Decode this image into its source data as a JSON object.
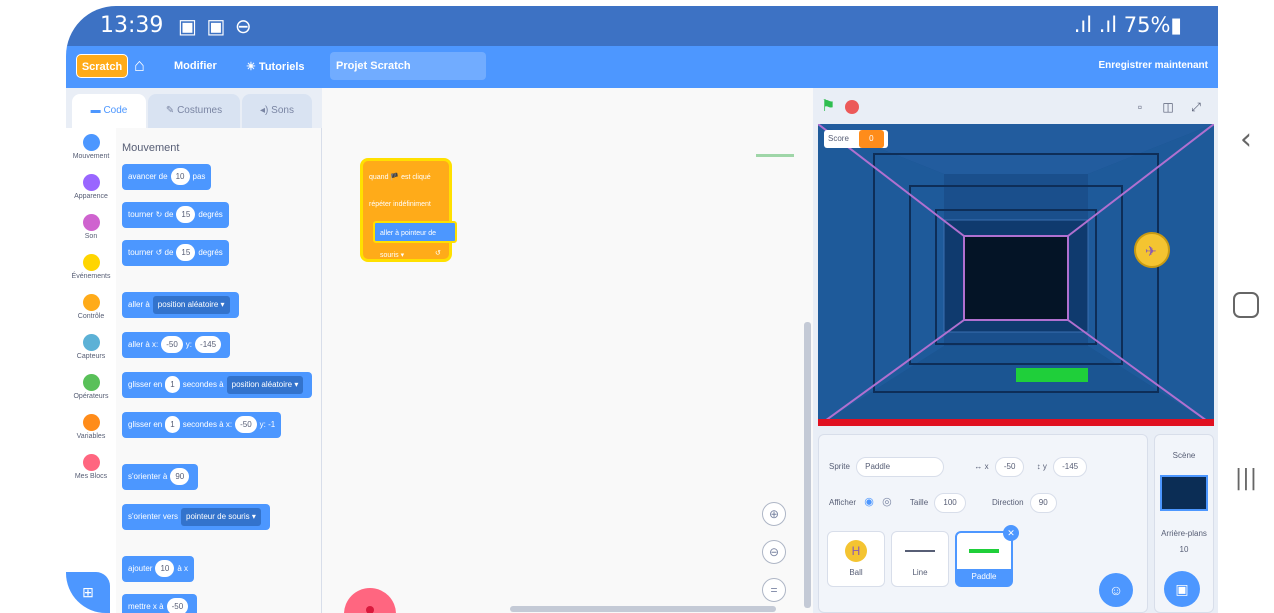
{
  "status_bar": {
    "time": "13:39",
    "left_icons": "▣ ▣ ⊖",
    "right": ".ıl .ıl 75%▮"
  },
  "menu": {
    "logo": "Scratch",
    "items": [
      "Modifier",
      "Tutoriels"
    ],
    "project_title": "Projet Scratch",
    "save_label": "Enregistrer maintenant"
  },
  "tabs": [
    "Code",
    "Costumes",
    "Sons"
  ],
  "categories": [
    {
      "label": "Mouvement",
      "color": "#4c97ff"
    },
    {
      "label": "Apparence",
      "color": "#9966ff"
    },
    {
      "label": "Son",
      "color": "#cf63cf"
    },
    {
      "label": "Événements",
      "color": "#ffd500"
    },
    {
      "label": "Contrôle",
      "color": "#ffab19"
    },
    {
      "label": "Capteurs",
      "color": "#5cb1d6"
    },
    {
      "label": "Opérateurs",
      "color": "#59c059"
    },
    {
      "label": "Variables",
      "color": "#ff8c1a"
    },
    {
      "label": "Mes Blocs",
      "color": "#ff6680"
    }
  ],
  "palette": {
    "title": "Mouvement",
    "blocks": [
      {
        "pre": "avancer de",
        "val": "10",
        "post": "pas"
      },
      {
        "pre": "tourner ↻ de",
        "val": "15",
        "post": "degrés"
      },
      {
        "pre": "tourner ↺ de",
        "val": "15",
        "post": "degrés"
      },
      {
        "pre": "aller à",
        "dd": "position aléatoire ▾",
        "post": ""
      },
      {
        "pre": "aller à x:",
        "val": "-50",
        "mid": "y:",
        "val2": "-145"
      },
      {
        "pre": "glisser en",
        "val": "1",
        "mid": "secondes à",
        "dd": "position aléatoire ▾"
      },
      {
        "pre": "glisser en",
        "val": "1",
        "mid": "secondes à x:",
        "val2": "-50",
        "post": "y: -1"
      },
      {
        "pre": "s'orienter à",
        "val": "90",
        "post": ""
      },
      {
        "pre": "s'orienter vers",
        "dd": "pointeur de souris ▾",
        "post": ""
      },
      {
        "pre": "ajouter",
        "val": "10",
        "post": "à x"
      },
      {
        "pre": "mettre x à",
        "val": "-50",
        "post": ""
      }
    ]
  },
  "script": {
    "hat": "quand 🏴 est cliqué",
    "loop": "répéter indéfiniment",
    "inner": "aller à pointeur de souris ▾"
  },
  "zoom": [
    "⊕",
    "⊖",
    "="
  ],
  "stage": {
    "score_label": "Score",
    "score_value": "0"
  },
  "sprite_info": {
    "sprite_label": "Sprite",
    "sprite_name": "Paddle",
    "x_label": "↔ x",
    "x_value": "-50",
    "y_label": "↕ y",
    "y_value": "-145",
    "show_label": "Afficher",
    "size_label": "Taille",
    "size_value": "100",
    "direction_label": "Direction",
    "direction_value": "90"
  },
  "sprites": [
    {
      "name": "Ball",
      "icon": "ball-icon"
    },
    {
      "name": "Line",
      "icon": "line-icon"
    },
    {
      "name": "Paddle",
      "icon": "paddle-icon",
      "selected": true
    }
  ],
  "stage_panel": {
    "title": "Scène",
    "backdrops_label": "Arrière-plans",
    "backdrops_count": "10"
  }
}
